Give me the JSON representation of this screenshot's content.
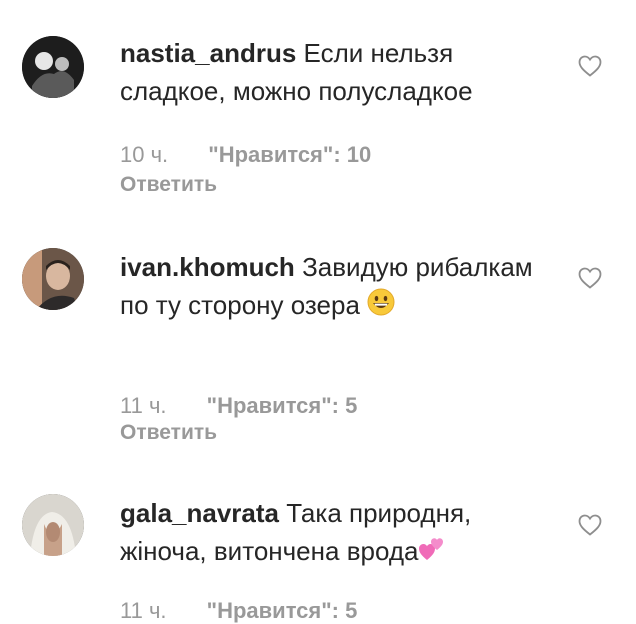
{
  "comments": [
    {
      "username": "nastia_andrus",
      "text": "Если нельзя сладкое, можно полусладкое",
      "time": "10 ч.",
      "likes": "\"Нравится\": 10",
      "reply": "Ответить",
      "heart_icon": "heart-outline-icon"
    },
    {
      "username": "ivan.khomuch",
      "text": "Завидую рибалкам по ту сторону озера",
      "emoji": "grinning-face-emoji",
      "time": "11 ч.",
      "likes": "\"Нравится\": 5",
      "reply": "Ответить",
      "heart_icon": "heart-outline-icon"
    },
    {
      "username": "gala_navrata",
      "text": "Така природня, жіноча, витончена врода",
      "emoji": "two-hearts-emoji",
      "time": "11 ч.",
      "likes": "\"Нравится\": 5",
      "heart_icon": "heart-outline-icon"
    }
  ]
}
